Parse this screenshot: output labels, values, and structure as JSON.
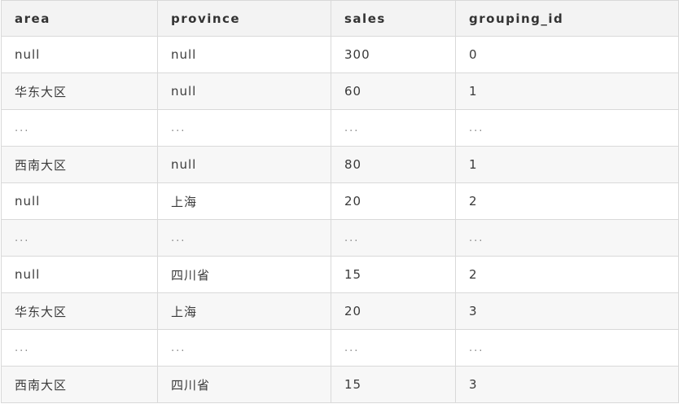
{
  "table": {
    "columns": [
      "area",
      "province",
      "sales",
      "grouping_id"
    ],
    "rows": [
      [
        "null",
        "null",
        "300",
        "0"
      ],
      [
        "华东大区",
        "null",
        "60",
        "1"
      ],
      [
        "...",
        "...",
        "...",
        "..."
      ],
      [
        "西南大区",
        "null",
        "80",
        "1"
      ],
      [
        "null",
        "上海",
        "20",
        "2"
      ],
      [
        "...",
        "...",
        "...",
        "..."
      ],
      [
        "null",
        "四川省",
        "15",
        "2"
      ],
      [
        "华东大区",
        "上海",
        "20",
        "3"
      ],
      [
        "...",
        "...",
        "...",
        "..."
      ],
      [
        "西南大区",
        "四川省",
        "15",
        "3"
      ]
    ]
  }
}
